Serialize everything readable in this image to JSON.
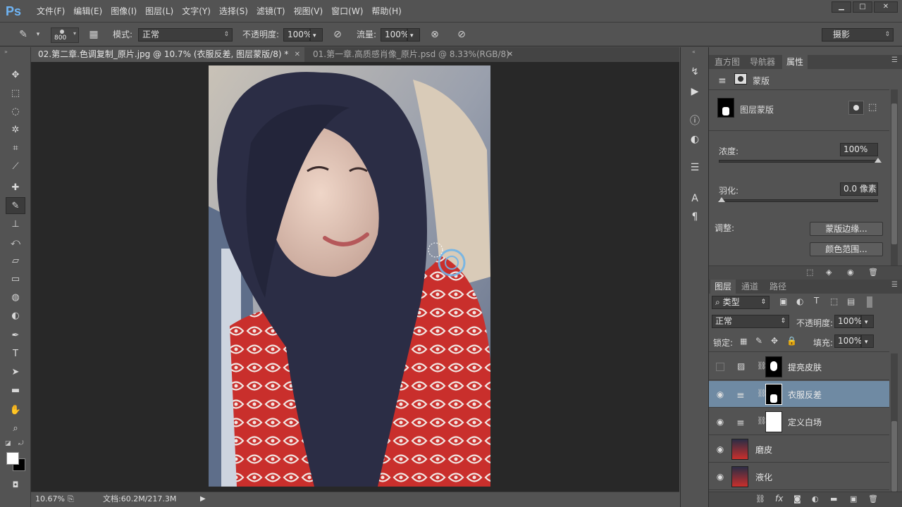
{
  "app": {
    "logo": "Ps"
  },
  "menu": [
    "文件(F)",
    "编辑(E)",
    "图像(I)",
    "图层(L)",
    "文字(Y)",
    "选择(S)",
    "滤镜(T)",
    "视图(V)",
    "窗口(W)",
    "帮助(H)"
  ],
  "window_controls": {
    "minimize": "▁",
    "maximize": "□",
    "close": "✕"
  },
  "options": {
    "brush_size": "800",
    "mode_label": "模式:",
    "mode_value": "正常",
    "opacity_label": "不透明度:",
    "opacity_value": "100%",
    "flow_label": "流量:",
    "flow_value": "100%",
    "workspace": "摄影"
  },
  "tabs": [
    {
      "label": "02.第二章.色调复制_原片.jpg @ 10.7% (衣服反差, 图层蒙版/8) *",
      "close": "✕"
    },
    {
      "label": "01.第一章.高质感肖像_原片.psd @ 8.33%(RGB/8)",
      "close": "✕"
    }
  ],
  "status": {
    "zoom": "10.67%",
    "doc": "文档:60.2M/217.3M"
  },
  "properties": {
    "tabs": [
      "直方图",
      "导航器",
      "属性"
    ],
    "header": "蒙版",
    "mask_label": "图层蒙版",
    "density_label": "浓度:",
    "density_value": "100%",
    "density_level": 1.0,
    "feather_label": "羽化:",
    "feather_value": "0.0 像素",
    "feather_level": 0.0,
    "adjust_label": "调整:",
    "mask_edge_button": "蒙版边缘...",
    "color_range_button": "颜色范围..."
  },
  "layers_panel": {
    "tabs": [
      "图层",
      "通道",
      "路径"
    ],
    "filter_value": "类型",
    "blend_value": "正常",
    "opacity_label": "不透明度:",
    "opacity_value": "100%",
    "lock_label": "锁定:",
    "fill_label": "填充:",
    "fill_value": "100%",
    "layers": [
      {
        "name": "提亮皮肤",
        "visible": false,
        "selected": false
      },
      {
        "name": "衣服反差",
        "visible": true,
        "selected": true
      },
      {
        "name": "定义白场",
        "visible": true,
        "selected": false
      },
      {
        "name": "磨皮",
        "visible": true,
        "selected": false
      },
      {
        "name": "液化",
        "visible": true,
        "selected": false
      }
    ],
    "footer_icons": [
      "link-icon",
      "fx-icon",
      "mask-icon",
      "adjustment-icon",
      "group-icon",
      "new-layer-icon",
      "trash-icon"
    ],
    "fx_label": "fx"
  }
}
